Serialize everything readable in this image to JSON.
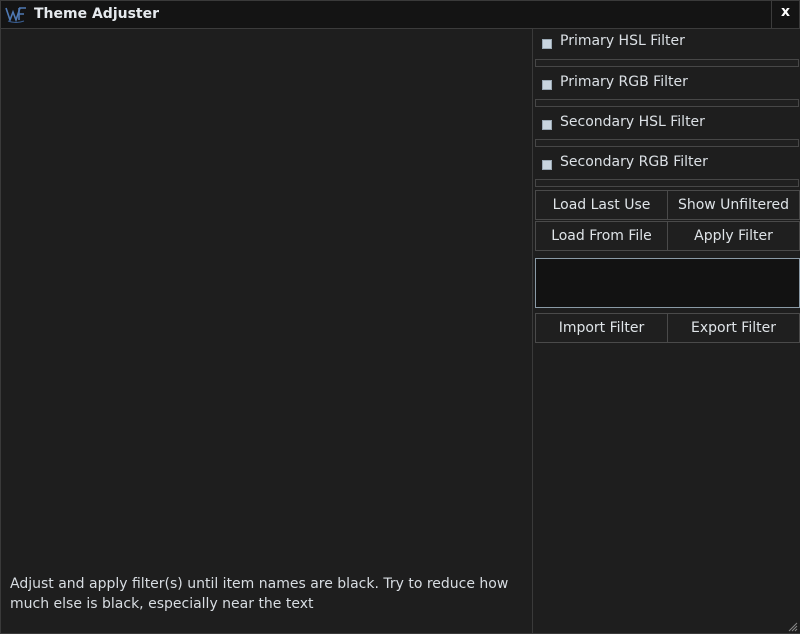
{
  "window": {
    "title": "Theme Adjuster",
    "close_label": "x"
  },
  "preview": {
    "hint": "Adjust and apply filter(s) until item names are black. Try to reduce how much else is black, especially near the text"
  },
  "filters": [
    {
      "label": "Primary HSL Filter",
      "checked": true
    },
    {
      "label": "Primary RGB Filter",
      "checked": true
    },
    {
      "label": "Secondary HSL Filter",
      "checked": true
    },
    {
      "label": "Secondary RGB Filter",
      "checked": true
    }
  ],
  "buttons": {
    "load_last_use": "Load Last Use",
    "show_unfiltered": "Show Unfiltered",
    "load_from_file": "Load From File",
    "apply_filter": "Apply Filter",
    "import_filter": "Import Filter",
    "export_filter": "Export Filter"
  },
  "filter_text": {
    "value": ""
  },
  "colors": {
    "background": "#1e1e1e",
    "titlebar": "#141414",
    "text": "#d6dbe0",
    "checkbox": "#c8d4df",
    "textbox_border": "#8a9aa6"
  }
}
